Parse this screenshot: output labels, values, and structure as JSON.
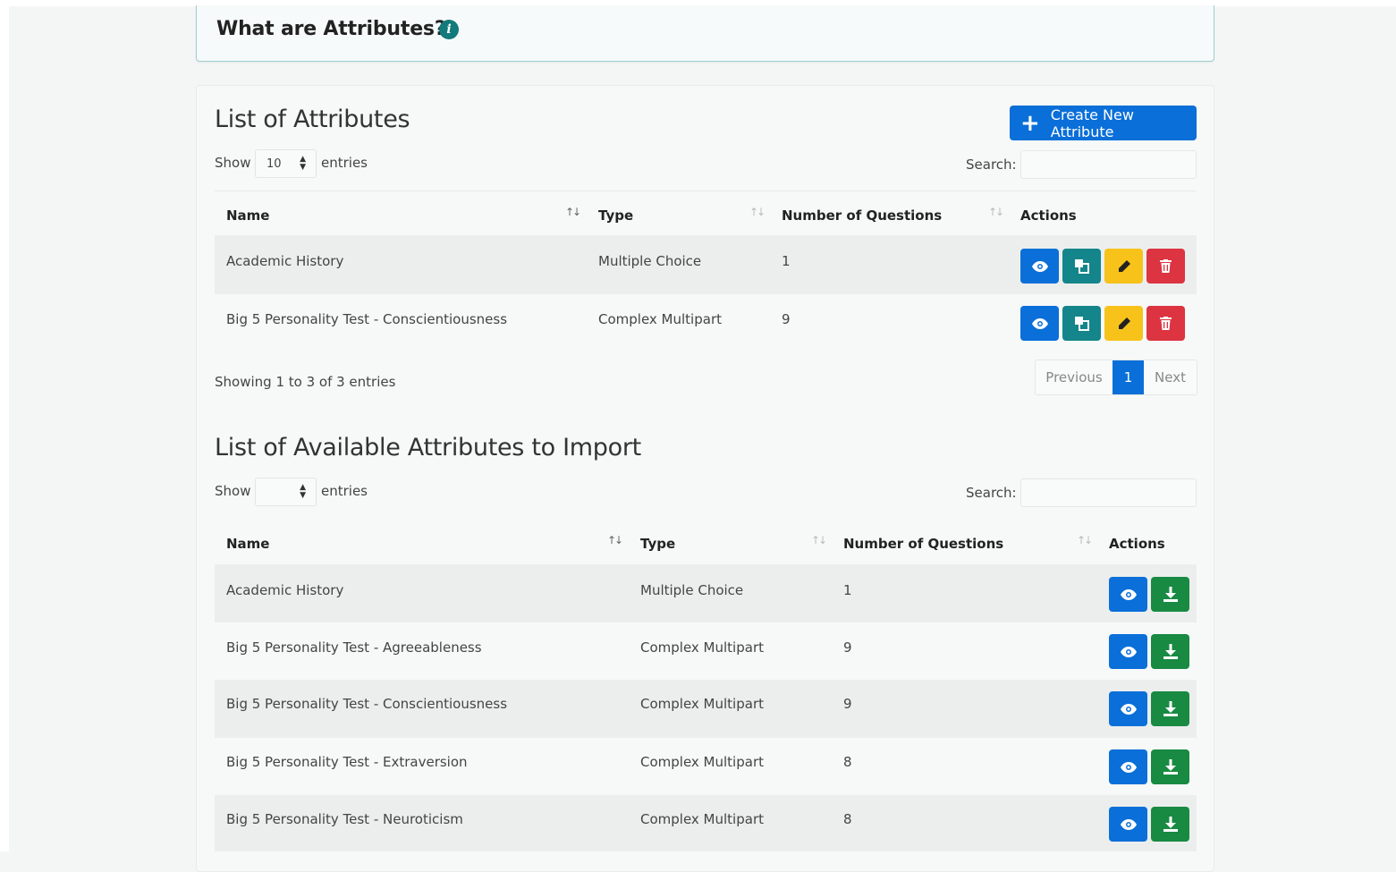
{
  "info": {
    "title": "What are Attributes?",
    "icon": "info-icon"
  },
  "attributes": {
    "title": "List of Attributes",
    "create_button": "Create New Attribute",
    "show_label": "Show",
    "entries_select": "10",
    "entries_label": "entries",
    "search_label": "Search:",
    "columns": [
      "Name",
      "Type",
      "Number of Questions",
      "Actions"
    ],
    "rows": [
      {
        "name": "Academic History",
        "type": "Multiple Choice",
        "questions": "1"
      },
      {
        "name": "Big 5 Personality Test - Conscientiousness",
        "type": "Complex Multipart",
        "questions": "9"
      }
    ],
    "showing": "Showing 1 to 3 of 3 entries",
    "pager": {
      "previous": "Previous",
      "current": "1",
      "next": "Next"
    }
  },
  "import": {
    "title": "List of Available Attributes to Import",
    "show_label": "Show",
    "entries_select": "",
    "entries_label": "entries",
    "search_label": "Search:",
    "columns": [
      "Name",
      "Type",
      "Number of Questions",
      "Actions"
    ],
    "rows": [
      {
        "name": "Academic History",
        "type": "Multiple Choice",
        "questions": "1"
      },
      {
        "name": "Big 5 Personality Test - Agreeableness",
        "type": "Complex Multipart",
        "questions": "9"
      },
      {
        "name": "Big 5 Personality Test - Conscientiousness",
        "type": "Complex Multipart",
        "questions": "9"
      },
      {
        "name": "Big 5 Personality Test - Extraversion",
        "type": "Complex Multipart",
        "questions": "8"
      },
      {
        "name": "Big 5 Personality Test - Neuroticism",
        "type": "Complex Multipart",
        "questions": "8"
      }
    ]
  },
  "colors": {
    "primary": "#0a6fd8",
    "teal": "#14858a",
    "warning": "#f7c21a",
    "danger": "#dc3440",
    "success": "#188a42"
  }
}
